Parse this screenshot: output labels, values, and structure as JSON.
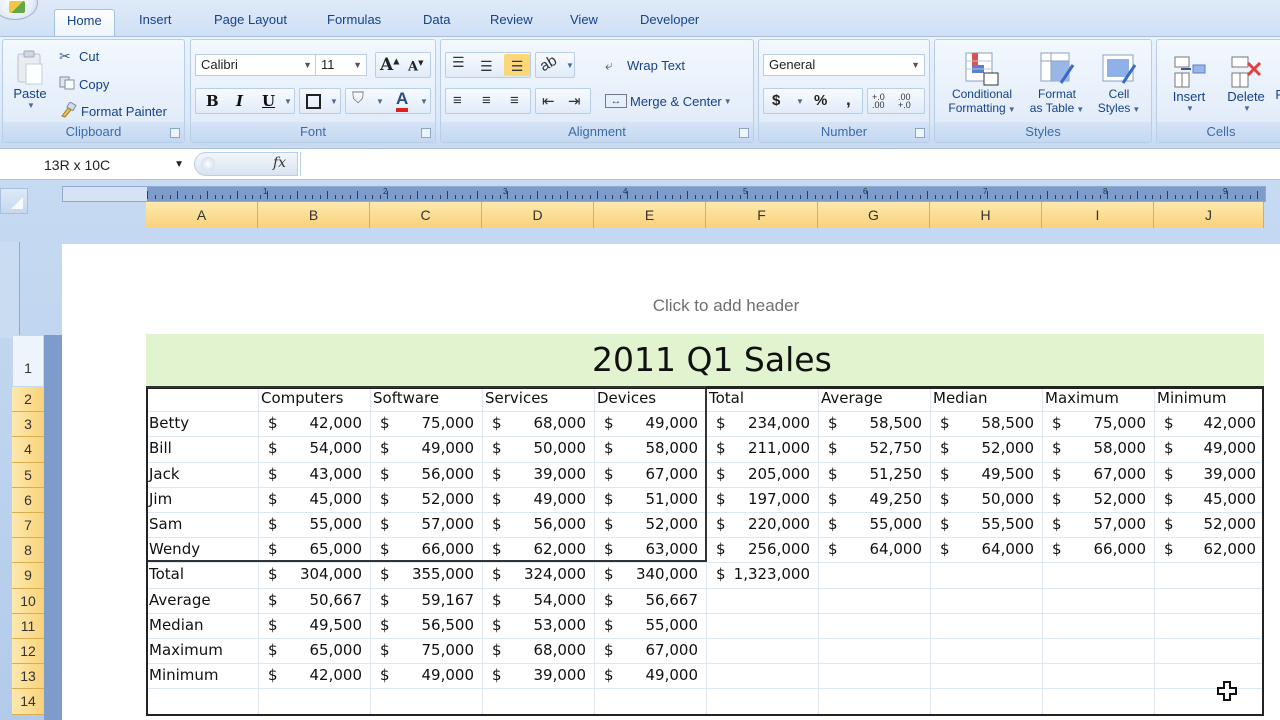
{
  "ribbon": {
    "tabs": [
      "Home",
      "Insert",
      "Page Layout",
      "Formulas",
      "Data",
      "Review",
      "View",
      "Developer"
    ],
    "active_tab": "Home",
    "clipboard": {
      "label": "Clipboard",
      "paste": "Paste",
      "cut": "Cut",
      "copy": "Copy",
      "format_painter": "Format Painter"
    },
    "font": {
      "label": "Font",
      "font_name": "Calibri",
      "font_size": "11",
      "bold": "B",
      "italic": "I",
      "underline": "U",
      "grow": "A",
      "shrink": "A",
      "font_color_label": "A",
      "font_color": "#e02020"
    },
    "alignment": {
      "label": "Alignment",
      "wrap_text": "Wrap Text",
      "merge_center": "Merge & Center"
    },
    "number": {
      "label": "Number",
      "format": "General",
      "currency": "$",
      "percent": "%",
      "comma": ",",
      "inc_decimal": "+.0 .00",
      "dec_decimal": ".00 +.0"
    },
    "styles": {
      "label": "Styles",
      "conditional_1": "Conditional",
      "conditional_2": "Formatting",
      "format_table_1": "Format",
      "format_table_2": "as Table",
      "cell_styles_1": "Cell",
      "cell_styles_2": "Styles"
    },
    "cells": {
      "label": "Cells",
      "insert": "Insert",
      "delete": "Delete",
      "format_partial": "Fo"
    }
  },
  "formula_bar": {
    "name_box": "13R x 10C",
    "fx": "fx",
    "formula": ""
  },
  "columns": [
    "A",
    "B",
    "C",
    "D",
    "E",
    "F",
    "G",
    "H",
    "I",
    "J"
  ],
  "rows": [
    "1",
    "2",
    "3",
    "4",
    "5",
    "6",
    "7",
    "8",
    "9",
    "10",
    "11",
    "12",
    "13",
    "14"
  ],
  "ruler_numbers": [
    "1",
    "2",
    "3",
    "4",
    "5",
    "6",
    "7",
    "8",
    "9"
  ],
  "page": {
    "header_hint": "Click to add header"
  },
  "sheet": {
    "title": "2011 Q1 Sales",
    "title_fill": "#e2f4cf",
    "headers": [
      "",
      "Computers",
      "Software",
      "Services",
      "Devices",
      "Total",
      "Average",
      "Median",
      "Maximum",
      "Minimum"
    ],
    "currency_symbol": "$",
    "people": [
      {
        "name": "Betty",
        "values": [
          "42,000",
          "75,000",
          "68,000",
          "49,000",
          "234,000",
          "58,500",
          "58,500",
          "75,000",
          "42,000"
        ]
      },
      {
        "name": "Bill",
        "values": [
          "54,000",
          "49,000",
          "50,000",
          "58,000",
          "211,000",
          "52,750",
          "52,000",
          "58,000",
          "49,000"
        ]
      },
      {
        "name": "Jack",
        "values": [
          "43,000",
          "56,000",
          "39,000",
          "67,000",
          "205,000",
          "51,250",
          "49,500",
          "67,000",
          "39,000"
        ]
      },
      {
        "name": "Jim",
        "values": [
          "45,000",
          "52,000",
          "49,000",
          "51,000",
          "197,000",
          "49,250",
          "50,000",
          "52,000",
          "45,000"
        ]
      },
      {
        "name": "Sam",
        "values": [
          "55,000",
          "57,000",
          "56,000",
          "52,000",
          "220,000",
          "55,000",
          "55,500",
          "57,000",
          "52,000"
        ]
      },
      {
        "name": "Wendy",
        "values": [
          "65,000",
          "66,000",
          "62,000",
          "63,000",
          "256,000",
          "64,000",
          "64,000",
          "66,000",
          "62,000"
        ]
      }
    ],
    "summary": [
      {
        "name": "Total",
        "values": [
          "304,000",
          "355,000",
          "324,000",
          "340,000",
          "1,323,000"
        ]
      },
      {
        "name": "Average",
        "values": [
          "50,667",
          "59,167",
          "54,000",
          "56,667"
        ]
      },
      {
        "name": "Median",
        "values": [
          "49,500",
          "56,500",
          "53,000",
          "55,000"
        ]
      },
      {
        "name": "Maximum",
        "values": [
          "65,000",
          "75,000",
          "68,000",
          "67,000"
        ]
      },
      {
        "name": "Minimum",
        "values": [
          "42,000",
          "49,000",
          "39,000",
          "49,000"
        ]
      }
    ]
  }
}
